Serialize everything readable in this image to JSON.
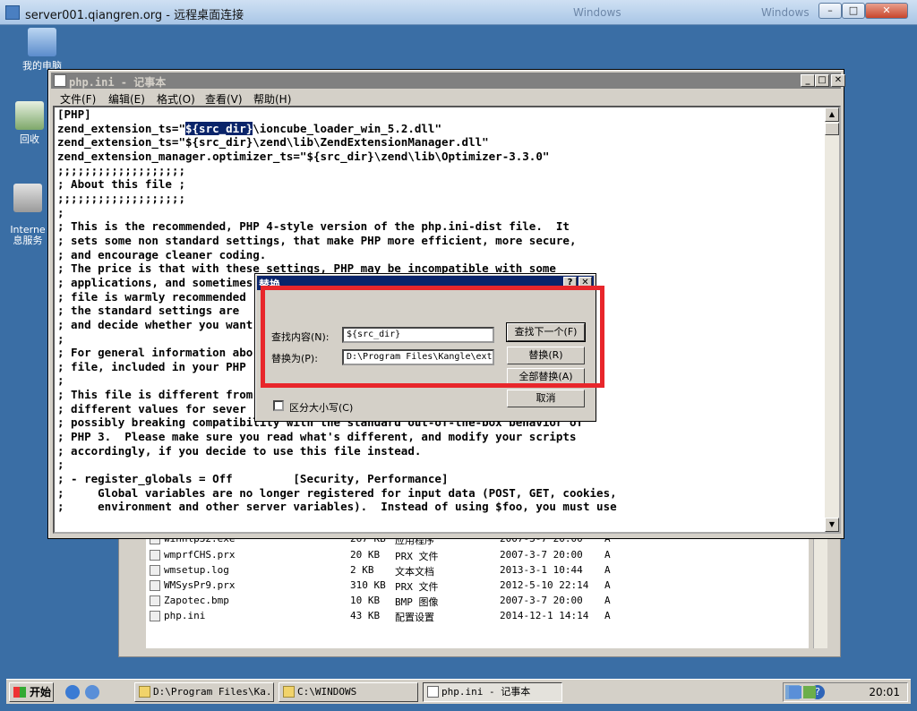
{
  "rdp": {
    "title": "server001.qiangren.org - 远程桌面连接",
    "ghost1": "Windows",
    "ghost2": "Windows",
    "min": "–",
    "max": "□",
    "close": "✕"
  },
  "desktop_icons": [
    {
      "label": "我的电脑"
    },
    {
      "label": "回收"
    },
    {
      "label": "Interne\n息服务"
    }
  ],
  "notepad": {
    "title": "php.ini - 记事本",
    "menu": [
      "文件(F)",
      "编辑(E)",
      "格式(O)",
      "查看(V)",
      "帮助(H)"
    ],
    "lines_before": [
      "[PHP]"
    ],
    "line_sel_pre": "zend_extension_ts=\"",
    "line_sel": "${src_dir}",
    "line_sel_post": "\\ioncube_loader_win_5.2.dll\"",
    "lines": [
      "zend_extension_ts=\"${src_dir}\\zend\\lib\\ZendExtensionManager.dll\"",
      "zend_extension_manager.optimizer_ts=\"${src_dir}\\zend\\lib\\Optimizer-3.3.0\"",
      ";;;;;;;;;;;;;;;;;;;",
      "; About this file ;",
      ";;;;;;;;;;;;;;;;;;;",
      ";",
      "; This is the recommended, PHP 4-style version of the php.ini-dist file.  It",
      "; sets some non standard settings, that make PHP more efficient, more secure,",
      "; and encourage cleaner coding.",
      "; The price is that with these settings, PHP may be incompatible with some",
      "; applications, and sometimes",
      "; file is warmly recommended",
      "; the standard settings are",
      "; and decide whether you want",
      ";",
      "; For general information abo                                      -dist",
      "; file, included in your PHP",
      ";",
      "; This file is different from                                      ares",
      "; different values for sever                                       while",
      "; possibly breaking compatibility with the standard out-of-the-box behavior of",
      "; PHP 3.  Please make sure you read what's different, and modify your scripts",
      "; accordingly, if you decide to use this file instead.",
      ";",
      "; - register_globals = Off         [Security, Performance]",
      ";     Global variables are no longer registered for input data (POST, GET, cookies,",
      ";     environment and other server variables).  Instead of using $foo, you must use"
    ]
  },
  "replace_dialog": {
    "title": "替换",
    "help": "?",
    "close": "✕",
    "find_label": "查找内容(N):",
    "find_value": "${src_dir}",
    "replace_label": "替换为(P):",
    "replace_value": "D:\\Program Files\\Kangle\\ext\\",
    "match_case": "区分大小写(C)",
    "btn_find_next": "查找下一个(F)",
    "btn_replace": "替换(R)",
    "btn_replace_all": "全部替换(A)",
    "btn_cancel": "取消"
  },
  "explorer": {
    "rows": [
      {
        "name": "winhlp32.exe",
        "size": "267 KB",
        "type": "应用程序",
        "date": "2007-3-7 20:00",
        "attr": "A"
      },
      {
        "name": "wmprfCHS.prx",
        "size": "20 KB",
        "type": "PRX 文件",
        "date": "2007-3-7 20:00",
        "attr": "A"
      },
      {
        "name": "wmsetup.log",
        "size": "2 KB",
        "type": "文本文档",
        "date": "2013-3-1 10:44",
        "attr": "A"
      },
      {
        "name": "WMSysPr9.prx",
        "size": "310 KB",
        "type": "PRX 文件",
        "date": "2012-5-10 22:14",
        "attr": "A"
      },
      {
        "name": "Zapotec.bmp",
        "size": "10 KB",
        "type": "BMP 图像",
        "date": "2007-3-7 20:00",
        "attr": "A"
      },
      {
        "name": "php.ini",
        "size": "43 KB",
        "type": "配置设置",
        "date": "2014-12-1 14:14",
        "attr": "A"
      }
    ]
  },
  "taskbar": {
    "start": "开始",
    "tasks": [
      "D:\\Program Files\\Ka...",
      "C:\\WINDOWS",
      "php.ini - 记事本"
    ],
    "clock": "20:01"
  }
}
